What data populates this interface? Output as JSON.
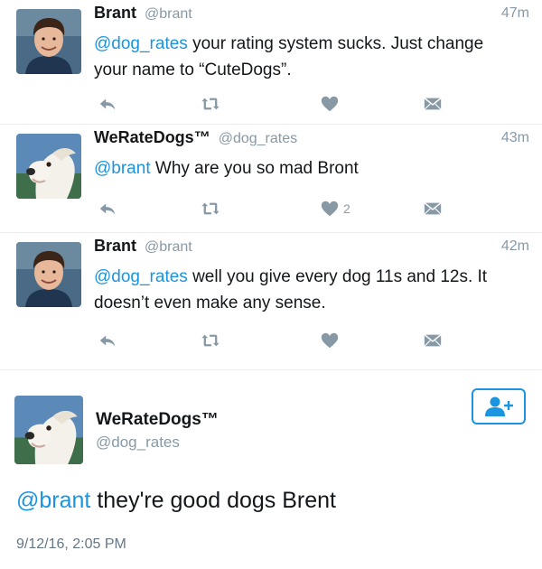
{
  "tweets": [
    {
      "display_name": "Brant",
      "handle": "@brant",
      "time": "47m",
      "mention": "@dog_rates",
      "text": " your rating system sucks. Just change your name to “CuteDogs”.",
      "like_count": ""
    },
    {
      "display_name": "WeRateDogs™",
      "handle": "@dog_rates",
      "time": "43m",
      "mention": "@brant",
      "text": " Why are you so mad Bront",
      "like_count": "2"
    },
    {
      "display_name": "Brant",
      "handle": "@brant",
      "time": "42m",
      "mention": "@dog_rates",
      "text": " well you give every dog 11s and 12s. It doesn’t even make any sense.",
      "like_count": ""
    }
  ],
  "focused": {
    "display_name": "WeRateDogs™",
    "handle": "@dog_rates",
    "mention": "@brant",
    "text": " they're good dogs Brent",
    "date": "9/12/16, 2:05 PM"
  },
  "icons": {
    "reply": "reply-icon",
    "retweet": "retweet-icon",
    "like": "heart-icon",
    "dm": "envelope-icon",
    "follow": "follow-user-icon"
  },
  "colors": {
    "link": "#1b95e0",
    "meta": "#8899a6",
    "text": "#14171a"
  }
}
